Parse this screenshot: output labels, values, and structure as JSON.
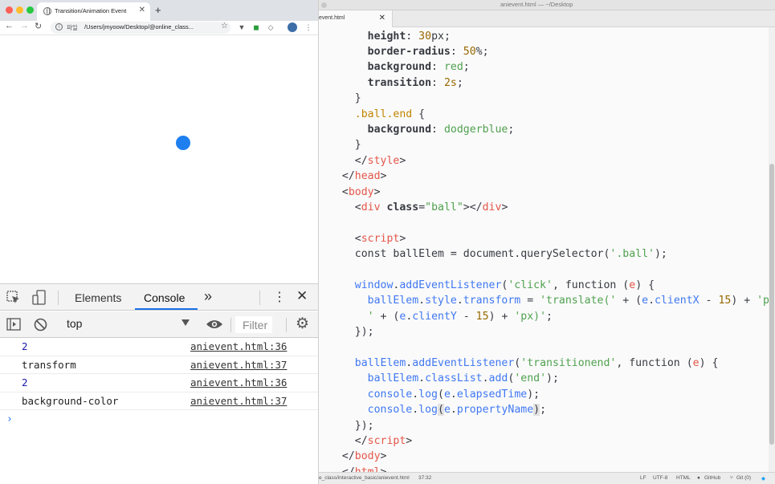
{
  "browser": {
    "tab_title": "Transition/Animation Event",
    "new_tab_symbol": "+",
    "scheme_label": "파일",
    "url": "/Users/jmyoow/Desktop/@online_class...",
    "viewport": {
      "ball_color": "#1e7ff0"
    }
  },
  "devtools": {
    "tabs": [
      "Elements",
      "Console"
    ],
    "active_tab": "Console",
    "more_symbol": "»",
    "context": "top",
    "filter_placeholder": "Filter",
    "console_rows": [
      {
        "message": "2",
        "source": "anievent.html:36"
      },
      {
        "message": "transform",
        "source": "anievent.html:37"
      },
      {
        "message": "2",
        "source": "anievent.html:36"
      },
      {
        "message": "background-color",
        "source": "anievent.html:37"
      }
    ],
    "prompt_symbol": "›"
  },
  "editor": {
    "window_title": "anievent.html — ~/Desktop",
    "tab_name": "event.html",
    "status": {
      "path": "e_class/interactive_basic/anievent.html",
      "cursor": "37:32",
      "line_ending": "LF",
      "encoding": "UTF-8",
      "grammar": "HTML",
      "github": "GitHub",
      "git": "Git (0)"
    },
    "colors": {
      "keyword": "#a626a4",
      "tag": "#e45649",
      "function": "#4078f2",
      "string": "#50a14f",
      "number": "#986801"
    }
  }
}
